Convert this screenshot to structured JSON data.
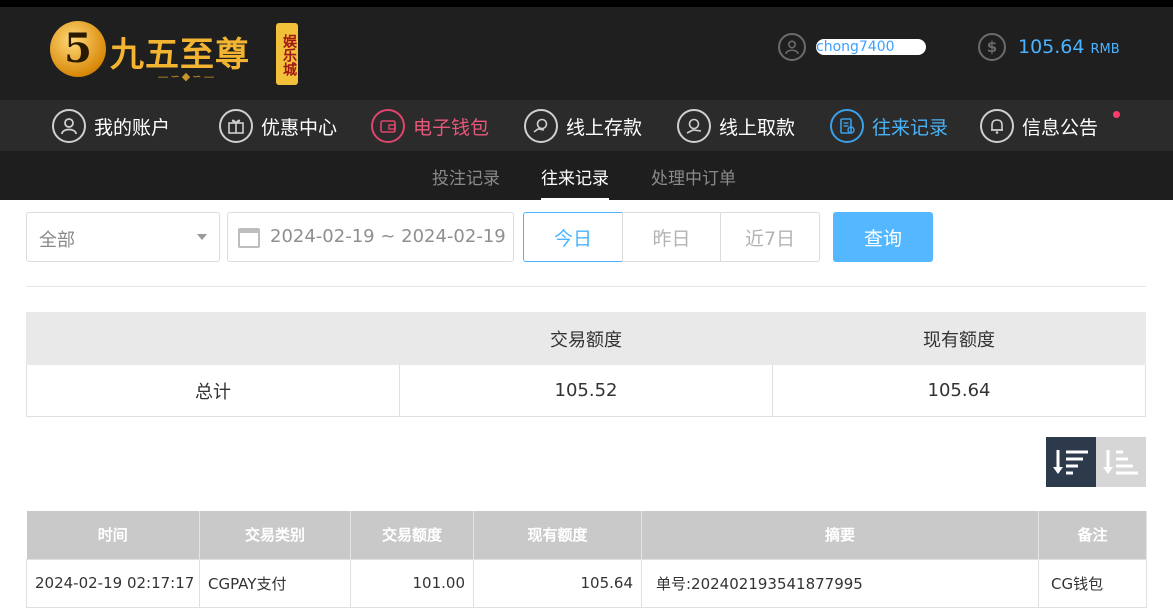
{
  "logo": {
    "numeral": "5",
    "name": "九五至尊",
    "badge": "娱乐城",
    "flourish": "—∽◆∽—"
  },
  "header": {
    "username": "chong7400",
    "balance": "105.64",
    "currency": "RMB"
  },
  "nav": {
    "items": [
      {
        "label": "我的账户",
        "icon": "user-icon"
      },
      {
        "label": "优惠中心",
        "icon": "gift-icon"
      },
      {
        "label": "电子钱包",
        "icon": "wallet-icon"
      },
      {
        "label": "线上存款",
        "icon": "deposit-icon"
      },
      {
        "label": "线上取款",
        "icon": "withdraw-icon"
      },
      {
        "label": "往来记录",
        "icon": "records-icon"
      },
      {
        "label": "信息公告",
        "icon": "bell-icon"
      }
    ],
    "active": "往来记录"
  },
  "subnav": {
    "items": [
      "投注记录",
      "往来记录",
      "处理中订单"
    ],
    "active": "往来记录"
  },
  "filters": {
    "type_value": "全部",
    "date_range": "2024-02-19 ~ 2024-02-19",
    "quick": [
      "今日",
      "昨日",
      "近7日"
    ],
    "active_quick": "今日",
    "search_label": "查询"
  },
  "summary": {
    "headers": [
      "",
      "交易额度",
      "现有额度"
    ],
    "row": {
      "label": "总计",
      "transaction": "105.52",
      "current": "105.64"
    }
  },
  "records": {
    "headers": [
      "时间",
      "交易类别",
      "交易额度",
      "现有额度",
      "摘要",
      "备注"
    ],
    "rows": [
      [
        "2024-02-19 02:17:17",
        "CGPAY支付",
        "101.00",
        "105.64",
        "单号:202402193541877995",
        "CG钱包"
      ]
    ]
  },
  "colors": {
    "header_bg": "#1f1f1f",
    "nav_bg": "#2b2b2b",
    "accent_blue": "#4ab3ff",
    "wallet_pink": "#e8587a",
    "search_button": "#55b7ff",
    "logo_gold": "#f3b431"
  }
}
